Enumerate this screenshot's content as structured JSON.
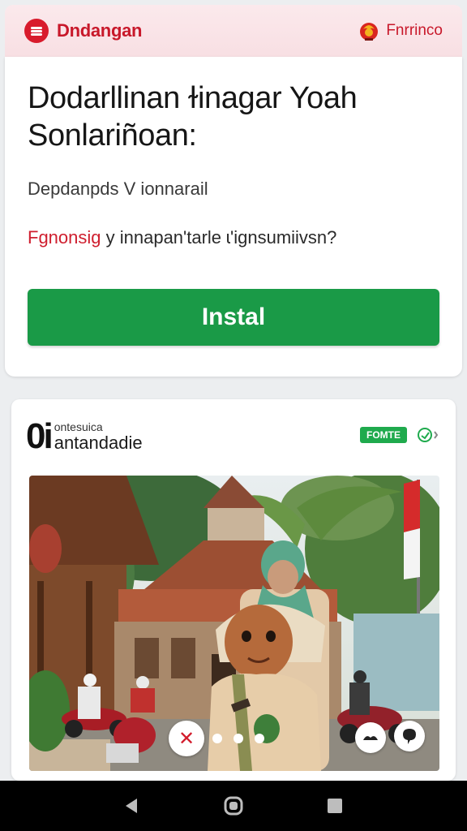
{
  "header": {
    "brand": "Dndangan",
    "right_label": "Fnrrinco",
    "menu_icon": "menu-icon",
    "emblem_icon": "emblem-icon"
  },
  "card1": {
    "headline": "Dodarllinan ɫinagar Yoah Sonlariñoan:",
    "subtitle": "Depdanpds V ionnarail",
    "question_accent": "Fgnonsig",
    "question_rest": " y innapan'tarle ɩ'ignsumiivsn?",
    "install_label": "Instal"
  },
  "card2": {
    "logo_mark": "0i",
    "logo_small": "ontesuica",
    "logo_big": "antandadie",
    "badge": "FOMTE",
    "share_icon": "share-icon",
    "close_symbol": "✕",
    "pager_dots": 3
  },
  "navbar": {
    "back_icon": "back-icon",
    "home_icon": "home-icon",
    "recents_icon": "recents-icon"
  },
  "colors": {
    "brand_red": "#c8182a",
    "install_green": "#1a9a47",
    "badge_green": "#1faa4d"
  }
}
